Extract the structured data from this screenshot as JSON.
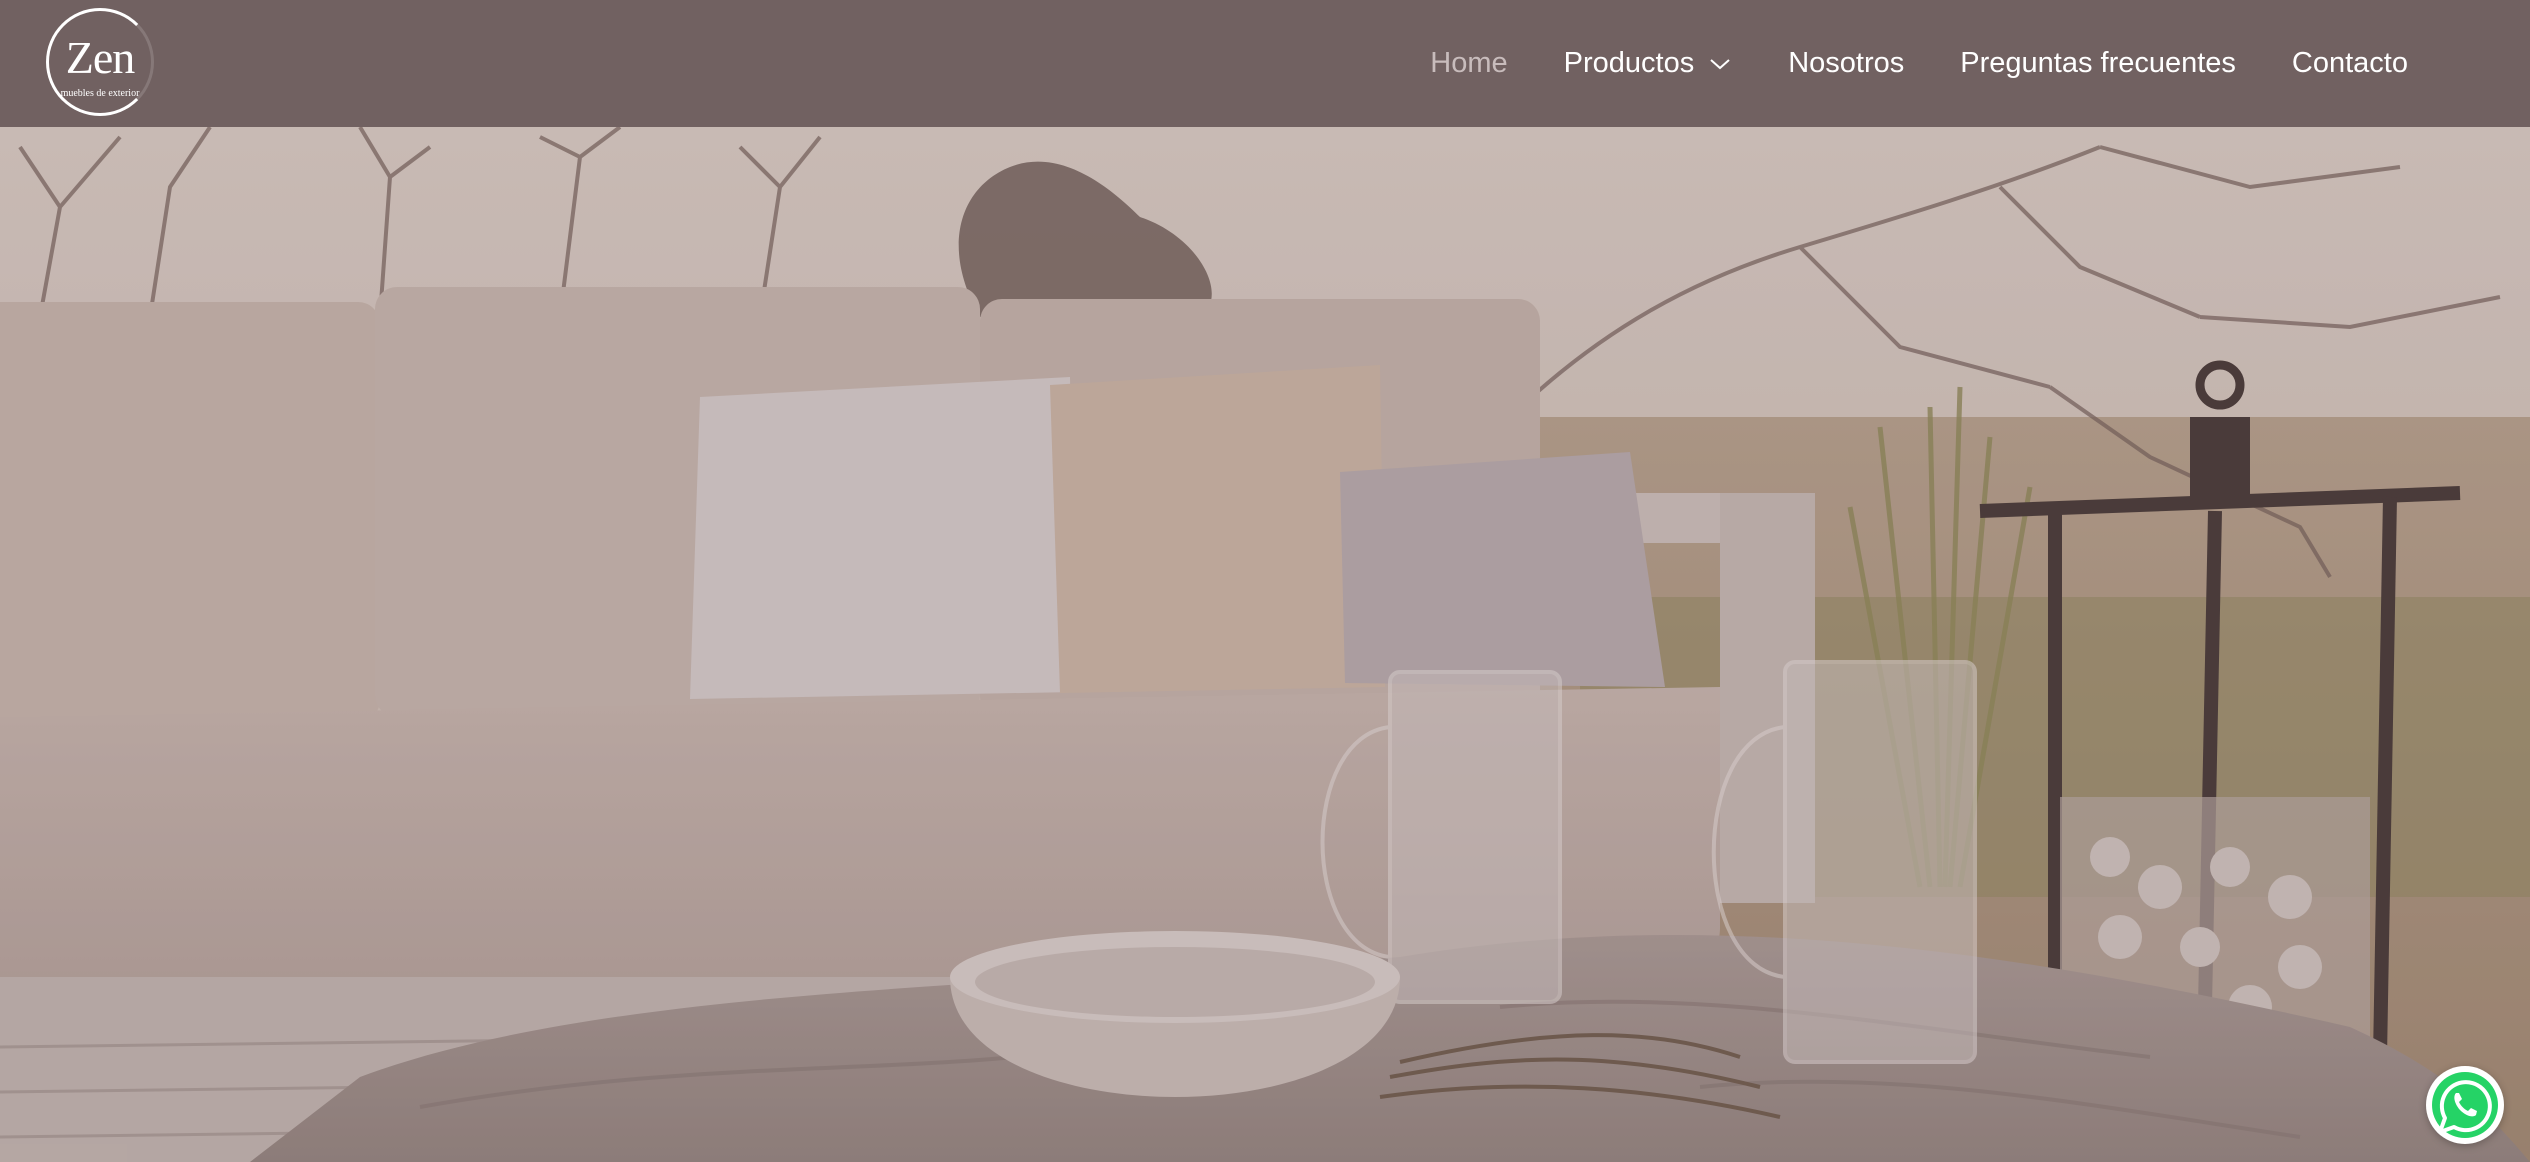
{
  "logo": {
    "word": "Zen",
    "tagline": "muebles de exterior"
  },
  "nav": {
    "home": "Home",
    "productos": "Productos",
    "nosotros": "Nosotros",
    "faq": "Preguntas frecuentes",
    "contacto": "Contacto"
  },
  "icons": {
    "productos_dropdown": "chevron-down-icon",
    "whatsapp": "whatsapp-icon"
  },
  "colors": {
    "header": "#716161",
    "nav_text": "#ffffff",
    "nav_active": "#c8bcbc",
    "whatsapp": "#25d366"
  }
}
